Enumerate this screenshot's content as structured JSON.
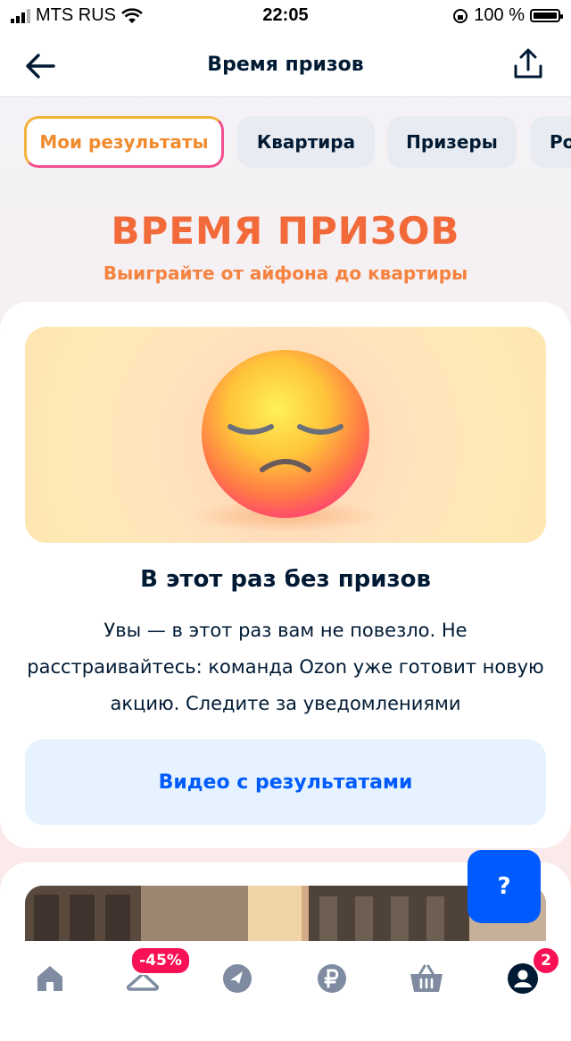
{
  "status_bar": {
    "carrier": "MTS RUS",
    "time": "22:05",
    "battery": "100 %"
  },
  "header": {
    "title": "Время призов"
  },
  "tabs": [
    {
      "label": "Мои результаты",
      "active": true
    },
    {
      "label": "Квартира",
      "active": false
    },
    {
      "label": "Призеры",
      "active": false
    },
    {
      "label": "Ро",
      "active": false
    }
  ],
  "hero": {
    "title": "ВРЕМЯ ПРИЗОВ",
    "subtitle": "Выиграйте от айфона до квартиры"
  },
  "result_card": {
    "title": "В этот раз без призов",
    "text": "Увы — в этот раз вам не повезло. Не расстраивайтесь: команда Ozon уже готовит новую акцию. Следите за уведомлениями",
    "button_label": "Видео с результатами"
  },
  "help_button": {
    "label": "?"
  },
  "bottom_nav": {
    "items": [
      {
        "icon": "home-icon"
      },
      {
        "icon": "hanger-icon",
        "badge": "-45%"
      },
      {
        "icon": "compass-icon"
      },
      {
        "icon": "ruble-icon"
      },
      {
        "icon": "basket-icon"
      },
      {
        "icon": "profile-icon",
        "badge": "2"
      }
    ]
  },
  "colors": {
    "brand_blue": "#005bff",
    "badge_pink": "#f91155",
    "hero_orange": "#f36a3a"
  }
}
